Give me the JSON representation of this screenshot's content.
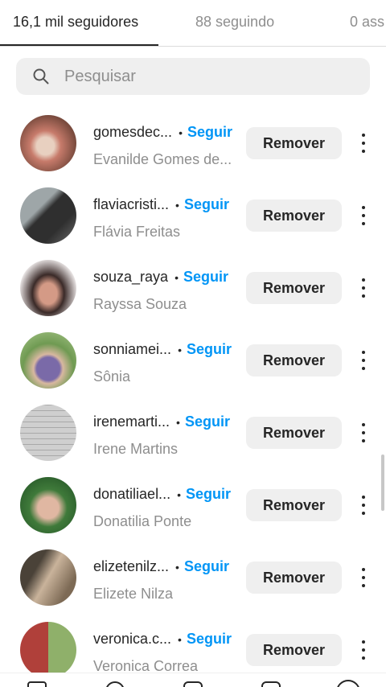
{
  "tabs": [
    {
      "label": "16,1 mil seguidores"
    },
    {
      "label": "88 seguindo"
    },
    {
      "label": "0 ass"
    }
  ],
  "search": {
    "placeholder": "Pesquisar"
  },
  "followers": [
    {
      "username": "gomesdec...",
      "fullname": "Evanilde Gomes de...",
      "follow_label": "Seguir",
      "remove_label": "Remover",
      "avatar_colors": [
        "#c77b6b",
        "#e8d0c0"
      ]
    },
    {
      "username": "flaviacristi...",
      "fullname": "Flávia Freitas",
      "follow_label": "Seguir",
      "remove_label": "Remover",
      "avatar_colors": [
        "#2f2f2f",
        "#9ea6a8"
      ]
    },
    {
      "username": "souza_raya",
      "fullname": "Rayssa Souza",
      "follow_label": "Seguir",
      "remove_label": "Remover",
      "avatar_colors": [
        "#3a2a28",
        "#d49a86"
      ]
    },
    {
      "username": "sonniamei...",
      "fullname": "Sônia",
      "follow_label": "Seguir",
      "remove_label": "Remover",
      "avatar_colors": [
        "#6f9a52",
        "#7a6aa8"
      ]
    },
    {
      "username": "irenemarti...",
      "fullname": "Irene Martins",
      "follow_label": "Seguir",
      "remove_label": "Remover",
      "avatar_colors": [
        "#bdbdbd",
        "#d8d8d8"
      ]
    },
    {
      "username": "donatiliael...",
      "fullname": "Donatilia Ponte",
      "follow_label": "Seguir",
      "remove_label": "Remover",
      "avatar_colors": [
        "#3f7a3a",
        "#e0b7a2"
      ]
    },
    {
      "username": "elizetenilz...",
      "fullname": "Elizete Nilza",
      "follow_label": "Seguir",
      "remove_label": "Remover",
      "avatar_colors": [
        "#4a4238",
        "#c9b39b"
      ]
    },
    {
      "username": "veronica.c...",
      "fullname": "Veronica Correa",
      "follow_label": "Seguir",
      "remove_label": "Remover",
      "avatar_colors": [
        "#b0403a",
        "#8fb06a"
      ]
    }
  ],
  "colors": {
    "accent": "#0095f6",
    "secondary_text": "#8e8e8e",
    "button_bg": "#efefef"
  }
}
